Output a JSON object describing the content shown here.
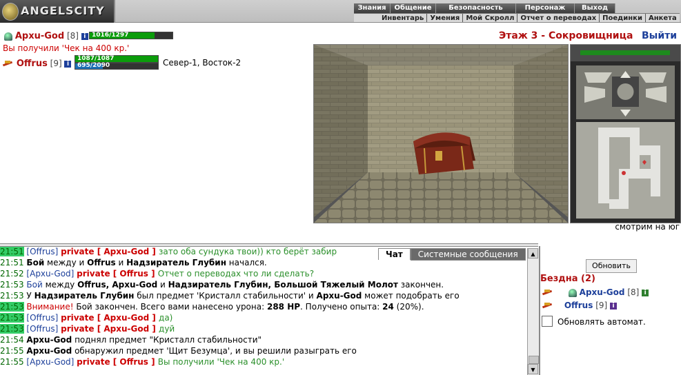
{
  "header": {
    "logo_text": "ANGELSCITY",
    "menu_top": [
      "Знания",
      "Общение",
      "Безопасность",
      "Персонаж",
      "Выход"
    ],
    "menu_bottom": [
      "Инвентарь",
      "Умения",
      "Мой Скролл",
      "Отчет о переводах",
      "Поединки",
      "Анкета"
    ]
  },
  "player": {
    "name": "Архu-God",
    "level": "[8]",
    "hp": "1016/1297",
    "hp_fraction": 0.78,
    "message": "Вы получили 'Чек на 400 кр.'"
  },
  "companion": {
    "name": "Offrus",
    "level": "[9]",
    "hp": "1087/1087",
    "hp_fraction": 1.0,
    "mp": "695/2090",
    "mp_fraction": 0.33,
    "coordinates": "Север-1, Восток-2"
  },
  "location": {
    "title": "Этаж 3 - Сокровищница",
    "exit_label": "Выйти",
    "status": "смотрим на юг"
  },
  "chat": {
    "tabs": [
      "Чат",
      "Системные сообщения"
    ],
    "lines": [
      {
        "time": "21:51",
        "hl": true,
        "parts": [
          [
            "pn",
            "[Offrus] "
          ],
          [
            "pvt",
            "private [ Архu-God ] "
          ],
          [
            "grn",
            "зато оба сундука твои)) кто берёт забир"
          ]
        ]
      },
      {
        "time": "21:51",
        "hl": false,
        "parts": [
          [
            "b",
            "Бой"
          ],
          [
            "",
            "  между и "
          ],
          [
            "b",
            "Offrus"
          ],
          [
            "",
            " и "
          ],
          [
            "b",
            "Надзиратель Глубин"
          ],
          [
            "",
            " начался."
          ]
        ]
      },
      {
        "time": "21:52",
        "hl": false,
        "parts": [
          [
            "pn",
            "[Архu-God] "
          ],
          [
            "pvt",
            "private [ Offrus ] "
          ],
          [
            "grn",
            "Отчет о переводах что ли сделать?"
          ]
        ]
      },
      {
        "time": "21:53",
        "hl": false,
        "parts": [
          [
            "blu",
            "Бой"
          ],
          [
            "",
            " между "
          ],
          [
            "b",
            "Offrus, Архu-God"
          ],
          [
            "",
            " и "
          ],
          [
            "b",
            "Надзиратель Глубин, Большой Тяжелый Молот"
          ],
          [
            "",
            " закончен."
          ]
        ]
      },
      {
        "time": "21:53",
        "hl": false,
        "parts": [
          [
            "",
            "У "
          ],
          [
            "b",
            "Надзиратель Глубин"
          ],
          [
            "",
            " был предмет 'Кристалл стабильности' и "
          ],
          [
            "b",
            "Архu-God"
          ],
          [
            "",
            " может подобрать его"
          ]
        ]
      },
      {
        "time": "21:53",
        "hl": true,
        "parts": [
          [
            "red",
            "Внимание!"
          ],
          [
            "",
            " Бой закончен. Всего вами нанесено урона: "
          ],
          [
            "b",
            "288 HP"
          ],
          [
            "",
            ". Получено опыта: "
          ],
          [
            "b",
            "24"
          ],
          [
            "",
            " (20%)."
          ]
        ]
      },
      {
        "time": "21:53",
        "hl": true,
        "parts": [
          [
            "pn",
            "[Offrus] "
          ],
          [
            "pvt",
            "private [ Архu-God ] "
          ],
          [
            "grn",
            "да)"
          ]
        ]
      },
      {
        "time": "21:53",
        "hl": true,
        "parts": [
          [
            "pn",
            "[Offrus] "
          ],
          [
            "pvt",
            "private [ Архu-God ] "
          ],
          [
            "grn",
            "дуй"
          ]
        ]
      },
      {
        "time": "21:54",
        "hl": false,
        "parts": [
          [
            "b",
            "Архu-God"
          ],
          [
            "",
            " поднял предмет \"Кристалл стабильности\""
          ]
        ]
      },
      {
        "time": "21:55",
        "hl": false,
        "parts": [
          [
            "b",
            "Архu-God"
          ],
          [
            "",
            " обнаружил предмет 'Щит Безумца', и вы решили разыграть его"
          ]
        ]
      },
      {
        "time": "21:55",
        "hl": false,
        "parts": [
          [
            "pn",
            "[Архu-God] "
          ],
          [
            "pvt",
            "private [ Offrus ] "
          ],
          [
            "grn",
            "Вы получили 'Чек на 400 кр.'"
          ]
        ]
      }
    ]
  },
  "room": {
    "refresh_label": "Обновить",
    "title": "Бездна (2)",
    "members": [
      {
        "name": "Архu-God",
        "level": "[8]"
      },
      {
        "name": "Offrus",
        "level": "[9]"
      }
    ],
    "auto_refresh_label": "Обновлять автомат."
  },
  "colors": {
    "accent_red": "#b01010",
    "link_blue": "#1c3f9a",
    "hp_green": "#0b9c0b",
    "mp_blue": "#1d6fb5"
  }
}
